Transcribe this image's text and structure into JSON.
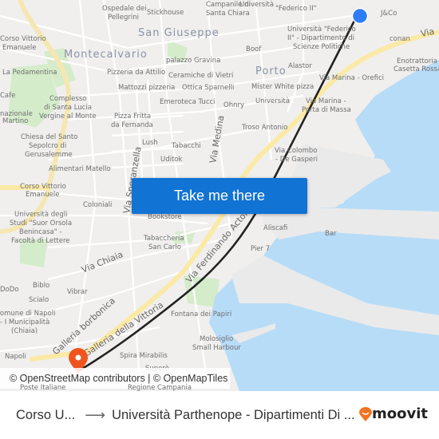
{
  "map": {
    "colors": {
      "land": "#f0efee",
      "water": "#b7dcf7",
      "park": "#d5eccb",
      "major_road": "#fbe9a6",
      "route": "#222222",
      "origin_marker": "#2f7df6",
      "destination_marker": "#f0541e",
      "button": "#1173d4"
    },
    "labels": [
      "Ospedale dei",
      "Pellegrini",
      "Stickhouse",
      "Campanile di",
      "Santa Chiara",
      "Università",
      "\"Federico II\"",
      "J&Co",
      "San Giuseppe",
      "Corso Vittorio",
      "Emanuele",
      "Montecalvario",
      "palazzo Gravina",
      "Boof",
      "Università \"Federico",
      "II\" - Dipartimento di",
      "Scienze Politiche",
      "conan",
      "Enotrattoria",
      "Casetta Rossa",
      "La Pedamentina",
      "Pizzeria da Attilio",
      "Ceramiche di Vietri",
      "Porto",
      "Alastor",
      "Mattozzi pizzeria",
      "Ottica Sparnelli",
      "Mister White pizza",
      "Via Marina - Orefici",
      "Cafe",
      "Complesso",
      "di Santa Lucia",
      "Vergine al Monte",
      "Emeroteca Tucci",
      "Ohnry",
      "Università",
      "Via Marina -",
      "Porta di Massa",
      "nazionale",
      "Martino",
      "Pizza Fritta",
      "da Fernanda",
      "Troso Antonio",
      "Chiesa del Santo",
      "Sepolcro di",
      "Gerusalemme",
      "Lush",
      "Tabacchi",
      "Uditok",
      "Via Colombo",
      "- De Gasperi",
      "Alimentari Matello",
      "Corso Vittorio",
      "Emanuele",
      "Coloniali",
      "Bookstore",
      "Aliscafi",
      "Bar",
      "Università degli",
      "Studi \"Suor Orsola",
      "Benincasa\" -",
      "Facoltà di Lettere",
      "Tabaccheria",
      "San Carlo",
      "Pier 7",
      "Biblo",
      "DoDo",
      "Vibrar",
      "Scialo",
      "Comune di Napoli",
      "- I Municipalità",
      "(Chiaia)",
      "Fontana dei Papiri",
      "Molosiglio",
      "Small Harbour",
      "Spira Mirabilis",
      "Napoli",
      "Superò",
      "Poste Italiane",
      "Regione Campania"
    ],
    "streets": [
      "Via Medina",
      "Via Speranzella",
      "Via Chiaia",
      "Via Ferdinando Acton",
      "Galleria borbonica",
      "Galleria della Vittoria",
      "Via"
    ],
    "attribution": "© OpenStreetMap contributors | © OpenMapTiles",
    "cta_label": "Take me there"
  },
  "footer": {
    "origin": "Corso U...",
    "arrow_icon": "arrow-right-icon",
    "destination": "Università Parthenope - Dipartimenti Di ...",
    "brand": "moovit"
  }
}
